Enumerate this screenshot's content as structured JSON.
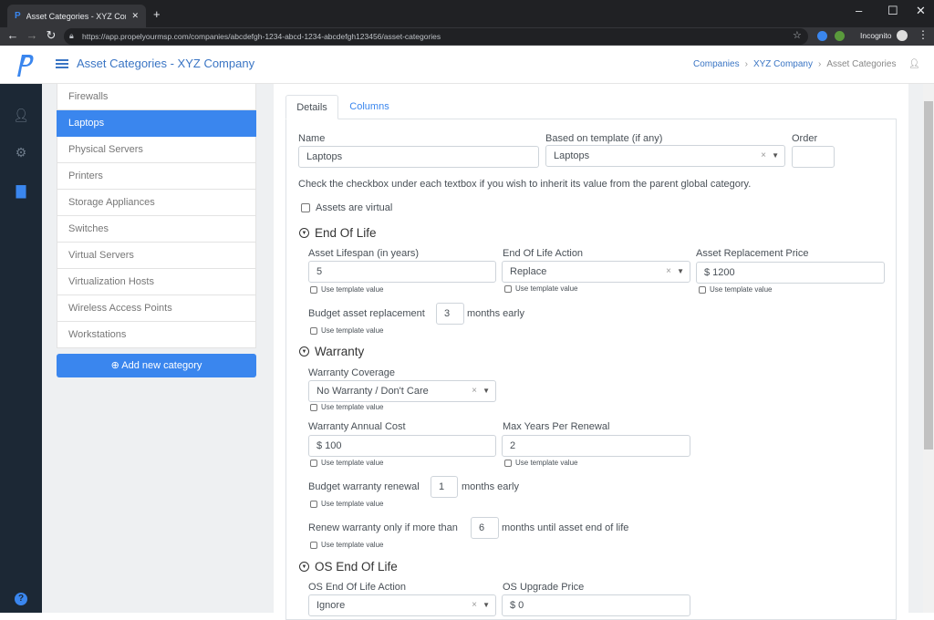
{
  "browser": {
    "tab_title": "Asset Categories - XYZ Company",
    "url": "https://app.propelyourmsp.com/companies/abcdefgh-1234-abcd-1234-abcdefgh123456/asset-categories",
    "incognito": "Incognito"
  },
  "header": {
    "title": "Asset Categories - XYZ Company",
    "breadcrumbs": [
      "Companies",
      "XYZ Company",
      "Asset Categories"
    ]
  },
  "sidebar": {
    "items": [
      "Firewalls",
      "Laptops",
      "Physical Servers",
      "Printers",
      "Storage Appliances",
      "Switches",
      "Virtual Servers",
      "Virtualization Hosts",
      "Wireless Access Points",
      "Workstations"
    ],
    "active": "Laptops",
    "add_label": "Add new category"
  },
  "tabs": [
    "Details",
    "Columns"
  ],
  "form": {
    "name_label": "Name",
    "name_value": "Laptops",
    "template_label": "Based on template (if any)",
    "template_value": "Laptops",
    "order_label": "Order",
    "order_value": "",
    "hint": "Check the checkbox under each textbox if you wish to inherit its value from the parent global category.",
    "virtual_label": "Assets are virtual",
    "use_template": "Use template value",
    "eol": {
      "heading": "End Of Life",
      "lifespan_label": "Asset Lifespan (in years)",
      "lifespan_value": "5",
      "action_label": "End Of Life Action",
      "action_value": "Replace",
      "price_label": "Asset Replacement Price",
      "price_value": "$ 1200",
      "budget_prefix": "Budget asset replacement",
      "budget_value": "3",
      "budget_suffix": "months early"
    },
    "warranty": {
      "heading": "Warranty",
      "coverage_label": "Warranty Coverage",
      "coverage_value": "No Warranty / Don't Care",
      "cost_label": "Warranty Annual Cost",
      "cost_value": "$ 100",
      "years_label": "Max Years Per Renewal",
      "years_value": "2",
      "budget_prefix": "Budget warranty renewal",
      "budget_value": "1",
      "budget_suffix": "months early",
      "renew_prefix": "Renew warranty only if more than",
      "renew_value": "6",
      "renew_suffix": "months until asset end of life"
    },
    "os": {
      "heading": "OS End Of Life",
      "action_label": "OS End Of Life Action",
      "action_value": "Ignore",
      "price_label": "OS Upgrade Price",
      "price_value": "$ 0"
    }
  }
}
